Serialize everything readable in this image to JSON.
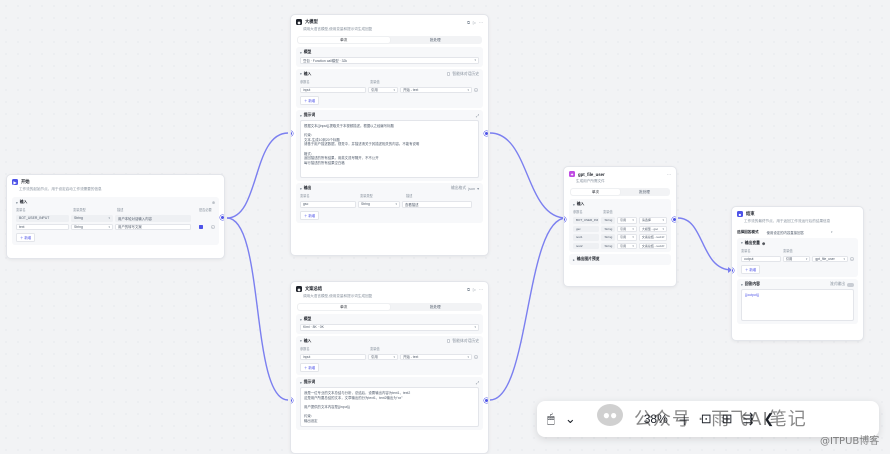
{
  "start": {
    "title": "开始",
    "desc": "工作流的起始节点，用于设定启动工作流需要的信息",
    "section_label": "输入",
    "col_var": "变量名",
    "col_type": "变量类型",
    "col_desc": "描述",
    "col_required": "是否必要",
    "params": [
      {
        "name": "BOT_USER_INPUT",
        "type": "String",
        "desc": "用户本轮对话输入内容"
      },
      {
        "name": "text",
        "type": "String",
        "desc": "用户的转写文案"
      }
    ],
    "add_label": "新增"
  },
  "llm": {
    "title": "大模型",
    "desc": "调用大语言模型,使用变量和提示词生成回复",
    "tab_single": "单次",
    "tab_batch": "批处理",
    "model_label": "模型",
    "model_value": "豆包 · Function call模型 · 32k",
    "input_label": "输入",
    "input_right": "智能体对话历史",
    "col_name": "参数名",
    "col_value": "变量值",
    "param_name": "input",
    "param_mode": "引用",
    "param_ref": "开始 - text",
    "add_label": "新增",
    "prompt_label": "提示词",
    "prompt_text": "根据文本{{input}}提取关于本视频描述。根据以之经编写标题\n\n约束：\n文本-生成10到20个标题\n请基于用户描述数据，视觉中，并描述请关于其描述相关的内容。不能有说明\n\n格式：\n返回描述的所有结果，用英文逗号隔开，不不公开\n每行描述的所有结果空白格",
    "output_label": "输出",
    "output_right": "输出格式",
    "output_format": "json",
    "col_var": "变量名",
    "col_type": "变量类型",
    "col_desc": "描述",
    "out_name": "gsc",
    "out_type": "String",
    "out_desc": "查看描述"
  },
  "text": {
    "title": "文案总结",
    "desc": "调用大语言模型,使用变量和提示词生成回复",
    "tab_single": "单次",
    "tab_batch": "批处理",
    "model_label": "模型",
    "model_value": "Kimi · 8K · 0K",
    "input_label": "输入",
    "input_right": "智能体对话历史",
    "col_name": "参数名",
    "col_value": "变量值",
    "param_name": "input",
    "param_mode": "引用",
    "param_ref": "开始 - text",
    "add_label": "新增",
    "prompt_label": "提示词",
    "prompt_text": "我是一位专业的文本总结与分析，总结后，设置输出内容为text1，text2\n这是用户所要总结的文本，文章输出的分为text1，text2输出为“xx”\n\n用户提供的文本内容是{{input}}\n\n约束：\n输出设定"
  },
  "plugin": {
    "title": "gpt_file_user",
    "desc": "生成用户所需文件",
    "tab_single": "单次",
    "tab_batch": "批处理",
    "input_label": "输入",
    "col_name": "参数名",
    "col_value": "变量值",
    "rows": [
      {
        "name": "BOT_USER_INPUT",
        "type": "String",
        "mode": "引用",
        "ref": "请选择"
      },
      {
        "name": "gsc",
        "type": "String",
        "mode": "引用",
        "ref": "大模型 - gsc"
      },
      {
        "name": "text1",
        "type": "String",
        "mode": "引用",
        "ref": "文案总结 - text1"
      },
      {
        "name": "text2",
        "type": "String",
        "mode": "引用",
        "ref": "文案总结 - text2"
      }
    ],
    "output_label": "输出图片预览"
  },
  "end": {
    "title": "结束",
    "desc": "工作流的最终节点，用于返回工作流运行后的结果信息",
    "mode_label": "选择回答模式",
    "mode_value": "使用设定的内容直接回答",
    "output_label": "输出变量",
    "col_name": "变量名",
    "col_value": "变量值",
    "var_name": "output",
    "var_mode": "引用",
    "var_ref": "gpt_file_user",
    "add_label": "新增",
    "answer_label": "回答内容",
    "stream_label": "流式输出",
    "answer_text": "{{output}}"
  },
  "toolbar": {
    "zoom": "38%"
  },
  "watermark": {
    "wechat": "公众号 · 雨飞AI笔记",
    "itpub": "@ITPUB博客"
  },
  "colors": {
    "accent": "#4d53e8",
    "edge": "#7b7ff0",
    "plugin": "#c04ce3"
  }
}
